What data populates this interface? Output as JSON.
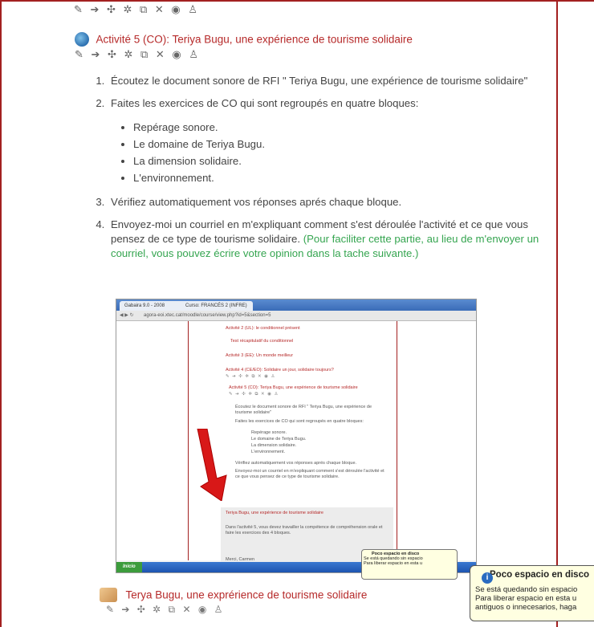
{
  "top_icons": "✎ ➔ ✣ ✲ ⧉ ✕ ◉ ♙",
  "activity": {
    "title": "Activité 5 (CO): Teriya Bugu, une expérience de tourisme solidaire",
    "edit_icons": "✎ ➔ ✣ ✲ ⧉ ✕ ◉ ♙"
  },
  "steps": [
    "Écoutez le document sonore de RFI \" Teriya Bugu, une expérience de tourisme solidaire\"",
    "Faites les exercices de CO qui sont regroupés en quatre bloques:",
    "Vérifiez automatiquement vos réponses aprés chaque bloque.",
    "Envoyez-moi un courriel en m'expliquant comment s'est déroulée l'activité et ce que vous pensez de ce type de tourisme solidaire."
  ],
  "step4_note": "(Pour faciliter cette partie, au lieu de m'envoyer un courriel, vous pouvez écrire votre opinion dans la tache suivante.)",
  "blocks": [
    "Repérage sonore.",
    "Le domaine de Teriya Bugu.",
    "La dimension solidaire.",
    "L'environnement."
  ],
  "screenshot": {
    "tab1": "Gabaira 9.0 - 2008",
    "tab2": "Curso: FRANCÉS 2 (INFRE)",
    "url": "agora-eoi.xtec.cat/moodle/course/view.php?id=5&section=5",
    "lines": [
      "Activité 2 (UL): le conditionnel présent",
      "Test récapitulatif du conditionnel",
      "Activité 3 (EE): Un monde meilleur",
      "Activité 4 (CE/EO): Solidaire un jour, solidaire toujours?",
      "Activité 5 (CO): Teriya Bugu, une expérience de tourisme solidaire"
    ],
    "box_title": "Teriya Bugu, une expérience de tourisme solidaire",
    "box_text": "Dans l'activité 5, vous devez travailler la compétence de compréhension orale et faire les exercices des 4 bloques.",
    "box_sign": "Merci, Carmen",
    "taskbar_start": "Inicio"
  },
  "balloon": {
    "title": "Poco espacio en disco",
    "line1": "Se está quedando sin espacio",
    "line2": "Para liberar espacio en esta u",
    "line3": "antiguos o innecesarios, haga"
  },
  "next_activity": {
    "title": "Terya Bugu, une exprérience de tourisme solidaire"
  },
  "colors": {
    "accent": "#a32020",
    "link": "#b62a2a",
    "green": "#35a550"
  }
}
